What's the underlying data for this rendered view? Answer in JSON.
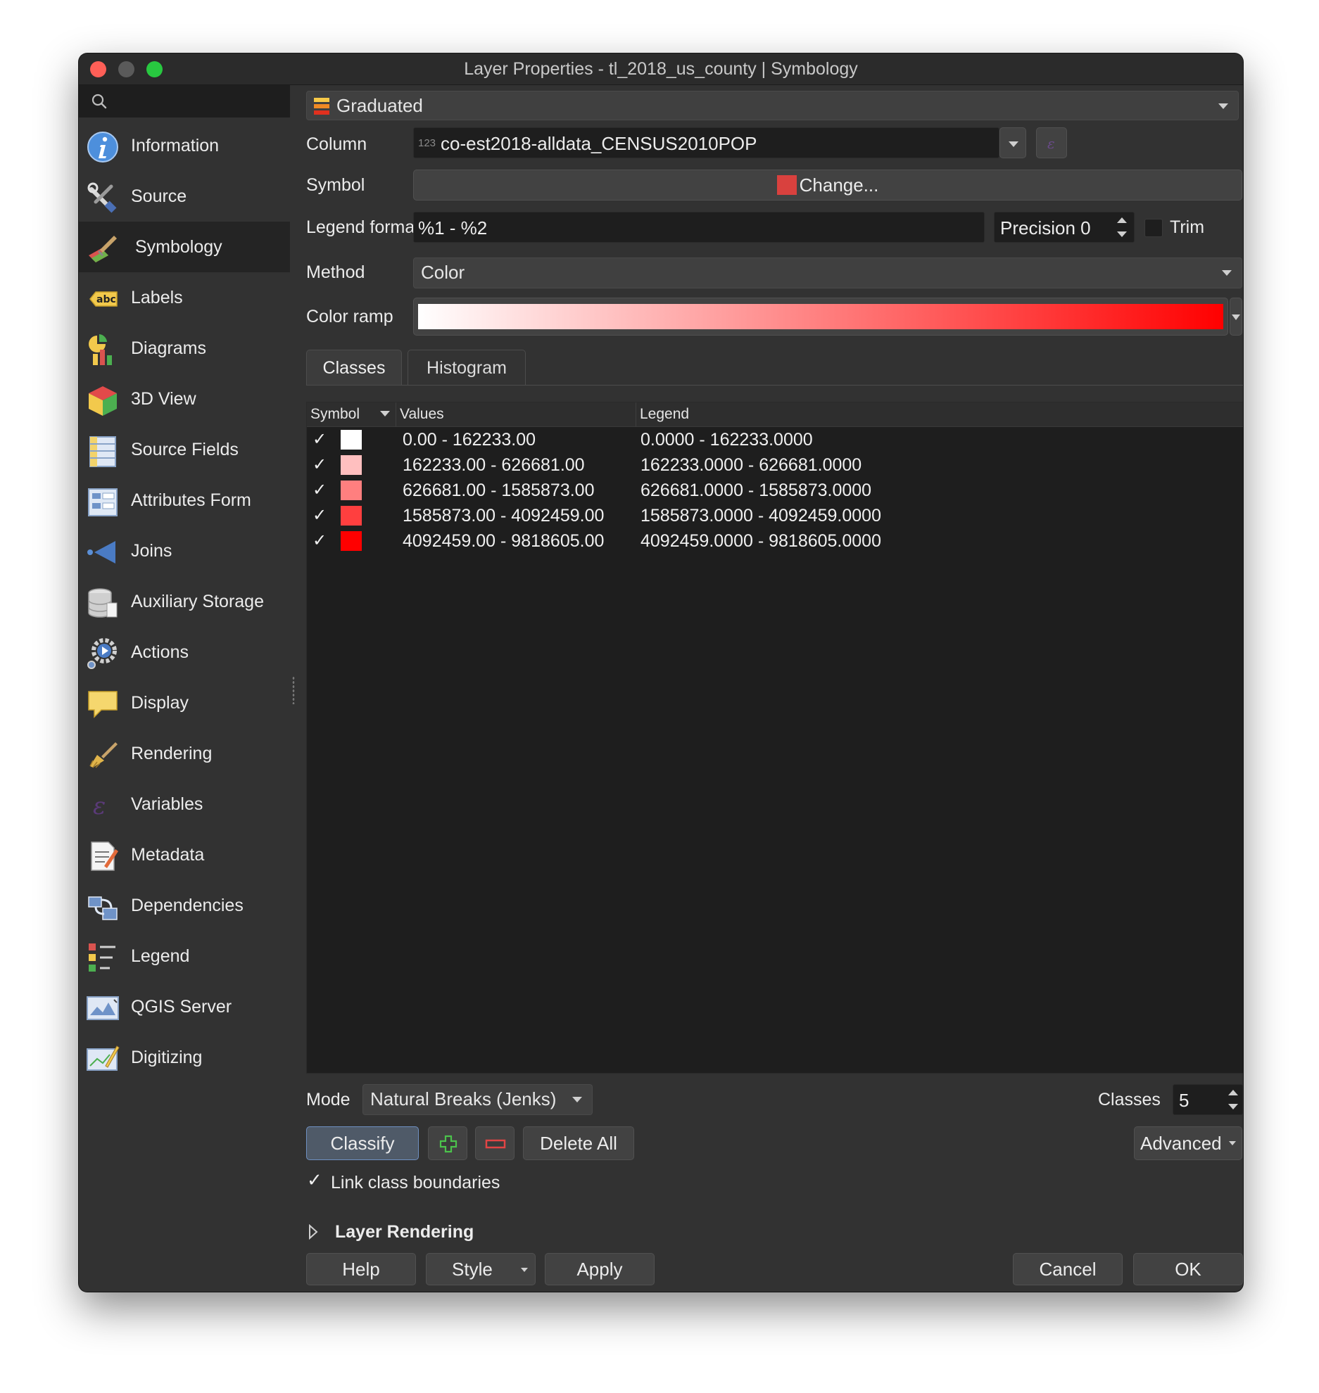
{
  "window": {
    "title": "Layer Properties - tl_2018_us_county | Symbology"
  },
  "sidebar": {
    "search_placeholder": "",
    "items": [
      {
        "label": "Information",
        "icon": "information-icon"
      },
      {
        "label": "Source",
        "icon": "source-tools-icon"
      },
      {
        "label": "Symbology",
        "icon": "symbology-paintbrush-icon"
      },
      {
        "label": "Labels",
        "icon": "labels-abc-icon"
      },
      {
        "label": "Diagrams",
        "icon": "diagrams-icon"
      },
      {
        "label": "3D View",
        "icon": "3d-cube-icon"
      },
      {
        "label": "Source Fields",
        "icon": "source-fields-icon"
      },
      {
        "label": "Attributes Form",
        "icon": "attributes-form-icon"
      },
      {
        "label": "Joins",
        "icon": "joins-icon"
      },
      {
        "label": "Auxiliary Storage",
        "icon": "database-icon"
      },
      {
        "label": "Actions",
        "icon": "actions-gear-icon"
      },
      {
        "label": "Display",
        "icon": "display-speech-bubble-icon"
      },
      {
        "label": "Rendering",
        "icon": "rendering-brush-icon"
      },
      {
        "label": "Variables",
        "icon": "variables-icon"
      },
      {
        "label": "Metadata",
        "icon": "metadata-icon"
      },
      {
        "label": "Dependencies",
        "icon": "dependencies-icon"
      },
      {
        "label": "Legend",
        "icon": "legend-icon"
      },
      {
        "label": "QGIS Server",
        "icon": "qgis-server-icon"
      },
      {
        "label": "Digitizing",
        "icon": "digitizing-icon"
      }
    ],
    "active_index": 2
  },
  "renderer": {
    "selected": "Graduated"
  },
  "form": {
    "column_label": "Column",
    "column_value": "co-est2018-alldata_CENSUS2010POP",
    "column_type_badge": "123",
    "symbol_label": "Symbol",
    "symbol_button": "Change...",
    "symbol_color": "#d9413e",
    "legend_format_label": "Legend format",
    "legend_format_value": "%1 - %2",
    "precision_label": "Precision 0",
    "trim_label": "Trim",
    "method_label": "Method",
    "method_value": "Color",
    "color_ramp_label": "Color ramp",
    "ramp_start": "#ffffff",
    "ramp_end": "#ff0000"
  },
  "tabs": {
    "classes": "Classes",
    "histogram": "Histogram"
  },
  "table": {
    "headers": {
      "symbol": "Symbol",
      "values": "Values",
      "legend": "Legend"
    },
    "rows": [
      {
        "checked": "✓",
        "color": "#ffffff",
        "values": "0.00 - 162233.00",
        "legend": "0.0000 - 162233.0000"
      },
      {
        "checked": "✓",
        "color": "#ffbfbf",
        "values": "162233.00 - 626681.00",
        "legend": "162233.0000 - 626681.0000"
      },
      {
        "checked": "✓",
        "color": "#ff7f7f",
        "values": "626681.00 - 1585873.00",
        "legend": "626681.0000 - 1585873.0000"
      },
      {
        "checked": "✓",
        "color": "#ff3f3f",
        "values": "1585873.00 - 4092459.00",
        "legend": "1585873.0000 - 4092459.0000"
      },
      {
        "checked": "✓",
        "color": "#ff0000",
        "values": "4092459.00 - 9818605.00",
        "legend": "4092459.0000 - 9818605.0000"
      }
    ]
  },
  "controls": {
    "mode_label": "Mode",
    "mode_value": "Natural Breaks (Jenks)",
    "classes_label": "Classes",
    "classes_value": "5",
    "classify": "Classify",
    "delete_all": "Delete All",
    "advanced": "Advanced",
    "link_boundaries": "Link class boundaries",
    "link_boundaries_check": "✓",
    "layer_rendering": "Layer Rendering"
  },
  "footer": {
    "help": "Help",
    "style": "Style",
    "apply": "Apply",
    "cancel": "Cancel",
    "ok": "OK"
  }
}
